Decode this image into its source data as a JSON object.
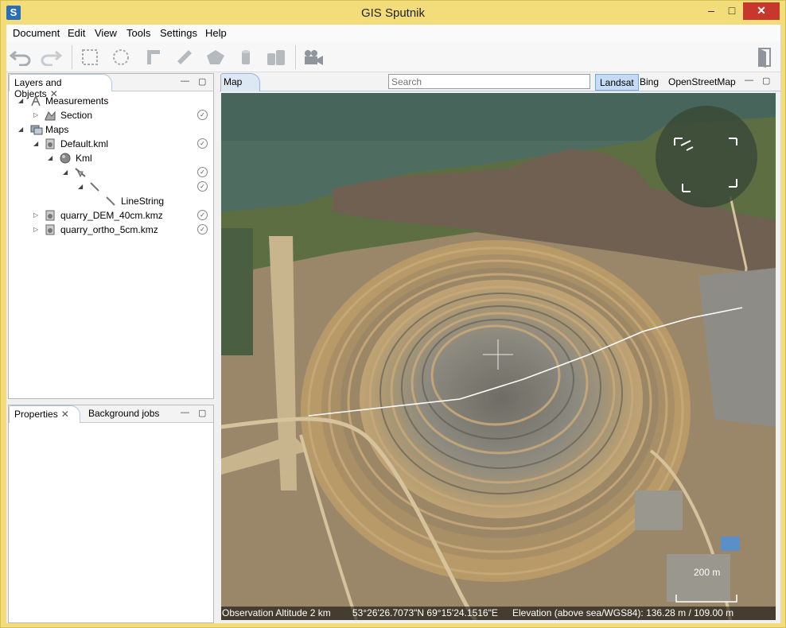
{
  "window": {
    "title": "GIS Sputnik",
    "app_icon": "S",
    "minimize": "–",
    "maximize": "□",
    "close": "✕"
  },
  "menu": [
    "Document",
    "Edit",
    "View",
    "Tools",
    "Settings",
    "Help"
  ],
  "toolbar": {
    "icons": [
      "undo-icon",
      "redo-icon",
      "select-rect-icon",
      "select-circle-icon",
      "ruler-icon",
      "measure-tape-icon",
      "area-icon",
      "cylinder-icon",
      "cylinders-icon",
      "video-camera-icon",
      "exit-icon"
    ]
  },
  "layers_panel": {
    "tab_label": "Layers and Objects",
    "close_glyph": "✕",
    "min_glyph": "—",
    "max_glyph": "▢",
    "tree": [
      {
        "label": "Measurements",
        "twisty": "◢",
        "icon": "measurement-icon",
        "check": false
      },
      {
        "label": "Section",
        "twisty": "▷",
        "icon": "section-icon",
        "check": true
      },
      {
        "label": "Maps",
        "twisty": "◢",
        "icon": "maps-icon",
        "check": false
      },
      {
        "label": "Default.kml",
        "twisty": "◢",
        "icon": "kml-file-icon",
        "check": true
      },
      {
        "label": "Kml",
        "twisty": "◢",
        "icon": "globe-icon",
        "check": false
      },
      {
        "label": "",
        "twisty": "◢",
        "icon": "placemark-icon",
        "check": true
      },
      {
        "label": "",
        "twisty": "◢",
        "icon": "line-icon",
        "check": true
      },
      {
        "label": "LineString",
        "twisty": "",
        "icon": "linestring-icon",
        "check": false
      },
      {
        "label": "quarry_DEM_40cm.kmz",
        "twisty": "▷",
        "icon": "kmz-file-icon",
        "check": true
      },
      {
        "label": "quarry_ortho_5cm.kmz",
        "twisty": "▷",
        "icon": "kmz-file-icon",
        "check": true
      }
    ]
  },
  "properties_panel": {
    "tabs": [
      "Properties",
      "Background jobs"
    ],
    "close_glyph": "✕",
    "min_glyph": "—",
    "max_glyph": "▢"
  },
  "map_panel": {
    "tab_label": "Map",
    "search_placeholder": "Search",
    "sources": [
      "Landsat",
      "Bing",
      "OpenStreetMap"
    ],
    "active_source": "Landsat",
    "min_glyph": "—",
    "max_glyph": "▢",
    "scale_label": "200 m",
    "status": {
      "altitude": "Observation Altitude 2 km",
      "coords": "53°26'26.7073\"N 69°15'24.1516\"E",
      "elevation": "Elevation (above sea/WGS84): 136.28 m / 109.00 m"
    }
  }
}
